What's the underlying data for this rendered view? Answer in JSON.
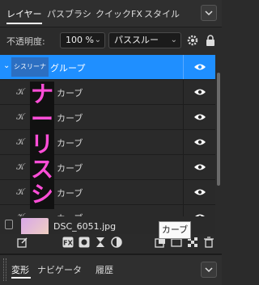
{
  "tabs": [
    {
      "label": "レイヤー",
      "active": true
    },
    {
      "label": "パスブラシ",
      "active": false
    },
    {
      "label": "クイックFX",
      "active": false
    },
    {
      "label": "スタイル",
      "active": false
    }
  ],
  "props": {
    "opacity_label": "不透明度:",
    "opacity_value": "100 %",
    "blend_mode": "パススルー"
  },
  "layers": {
    "group": {
      "thumb_text": "シスリーナ",
      "name": "グループ"
    },
    "curves": [
      {
        "name": "カーブ"
      },
      {
        "name": "カーブ"
      },
      {
        "name": "カーブ"
      },
      {
        "name": "カーブ"
      },
      {
        "name": "カーブ"
      },
      {
        "name": "カーブ"
      }
    ],
    "text_chars": [
      "ナ",
      "ー",
      "リ",
      "ス",
      "シ"
    ],
    "image": {
      "name": "DSC_6051.jpg"
    }
  },
  "tooltip": "カーブ",
  "bottom_tabs": [
    {
      "label": "変形",
      "active": true
    },
    {
      "label": "ナビゲータ",
      "active": false
    },
    {
      "label": "履歴",
      "active": false
    }
  ],
  "colors": {
    "selected": "#1f8fff",
    "text_pink": "#ff4ed8"
  }
}
